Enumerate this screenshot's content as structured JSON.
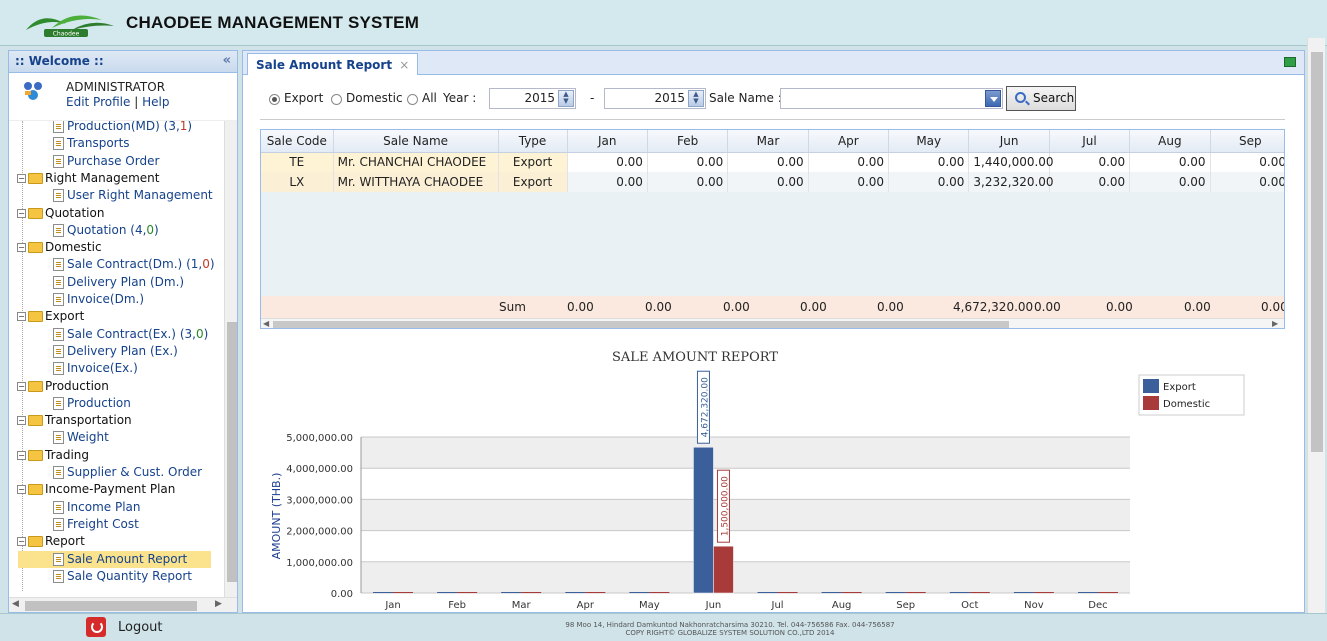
{
  "app": {
    "title": "CHAODEE MANAGEMENT SYSTEM",
    "logo_text": "Chaodee"
  },
  "sidebar": {
    "header": ":: Welcome ::",
    "user_name": "ADMINISTRATOR",
    "edit_profile": "Edit Profile",
    "sep": "|",
    "help": "Help",
    "tree": [
      {
        "type": "leaf",
        "label": "Production(MD)",
        "counts": [
          "(3,",
          "1",
          ")"
        ],
        "count_style": "c"
      },
      {
        "type": "leaf",
        "label": "Transports"
      },
      {
        "type": "leaf",
        "label": "Purchase Order"
      },
      {
        "type": "folder",
        "label": "Right Management"
      },
      {
        "type": "leaf",
        "label": "User Right Management"
      },
      {
        "type": "folder",
        "label": "Quotation"
      },
      {
        "type": "leaf",
        "label": "Quotation",
        "counts": [
          "(4,",
          "0",
          ")"
        ],
        "count_style": "b"
      },
      {
        "type": "folder",
        "label": "Domestic"
      },
      {
        "type": "leaf",
        "label": "Sale Contract(Dm.)",
        "counts": [
          "(1,",
          "0",
          ")"
        ],
        "count_style": "bc"
      },
      {
        "type": "leaf",
        "label": "Delivery Plan (Dm.)"
      },
      {
        "type": "leaf",
        "label": "Invoice(Dm.)"
      },
      {
        "type": "folder",
        "label": "Export"
      },
      {
        "type": "leaf",
        "label": "Sale Contract(Ex.)",
        "counts": [
          "(3,",
          "0",
          ")"
        ],
        "count_style": "b"
      },
      {
        "type": "leaf",
        "label": "Delivery Plan (Ex.)"
      },
      {
        "type": "leaf",
        "label": "Invoice(Ex.)"
      },
      {
        "type": "folder",
        "label": "Production"
      },
      {
        "type": "leaf",
        "label": "Production"
      },
      {
        "type": "folder",
        "label": "Transportation"
      },
      {
        "type": "leaf",
        "label": "Weight"
      },
      {
        "type": "folder",
        "label": "Trading"
      },
      {
        "type": "leaf",
        "label": "Supplier & Cust. Order"
      },
      {
        "type": "folder",
        "label": "Income-Payment Plan"
      },
      {
        "type": "leaf",
        "label": "Income Plan"
      },
      {
        "type": "leaf",
        "label": "Freight Cost"
      },
      {
        "type": "folder",
        "label": "Report"
      },
      {
        "type": "leaf",
        "label": "Sale Amount Report",
        "selected": true
      },
      {
        "type": "leaf",
        "label": "Sale Quantity Report"
      }
    ]
  },
  "tab": {
    "label": "Sale Amount Report",
    "close": "×"
  },
  "filter": {
    "export_label": "Export",
    "domestic_label": "Domestic",
    "all_label": "All",
    "selected": "Export",
    "year_label": "Year :",
    "year_from": "2015",
    "dash": "-",
    "year_to": "2015",
    "sale_name_label": "Sale Name :",
    "sale_name_value": "",
    "search_label": "Search"
  },
  "grid": {
    "columns": [
      "Sale Code",
      "Sale Name",
      "Type",
      "Jan",
      "Feb",
      "Mar",
      "Apr",
      "May",
      "Jun",
      "Jul",
      "Aug",
      "Sep"
    ],
    "rows": [
      [
        "TE",
        "Mr. CHANCHAI CHAODEE",
        "Export",
        "0.00",
        "0.00",
        "0.00",
        "0.00",
        "0.00",
        "1,440,000.00",
        "0.00",
        "0.00",
        "0.00"
      ],
      [
        "LX",
        "Mr. WITTHAYA CHAODEE",
        "Export",
        "0.00",
        "0.00",
        "0.00",
        "0.00",
        "0.00",
        "3,232,320.00",
        "0.00",
        "0.00",
        "0.00"
      ]
    ],
    "sum_label": "Sum",
    "sum_values": [
      "0.00",
      "0.00",
      "0.00",
      "0.00",
      "0.00",
      "4,672,320.00",
      "0.00",
      "0.00",
      "0.00",
      "0.00"
    ]
  },
  "chart_data": {
    "type": "bar",
    "title": "SALE AMOUNT REPORT",
    "ylabel": "AMOUNT (THB.)",
    "xlabel": "",
    "categories": [
      "Jan",
      "Feb",
      "Mar",
      "Apr",
      "May",
      "Jun",
      "Jul",
      "Aug",
      "Sep",
      "Oct",
      "Nov",
      "Dec"
    ],
    "series": [
      {
        "name": "Export",
        "color": "#3a5f9a",
        "values": [
          0,
          0,
          0,
          0,
          0,
          4672320,
          0,
          0,
          0,
          0,
          0,
          0
        ]
      },
      {
        "name": "Domestic",
        "color": "#a83a3a",
        "values": [
          0,
          0,
          0,
          0,
          0,
          1500000,
          0,
          0,
          0,
          0,
          0,
          0
        ]
      }
    ],
    "data_labels": [
      "4,672,320.00",
      "1,500,000.00"
    ],
    "yticks": [
      "0.00",
      "1,000,000.00",
      "2,000,000.00",
      "3,000,000.00",
      "4,000,000.00",
      "5,000,000.00"
    ],
    "ylim": [
      0,
      5000000
    ],
    "grid": true,
    "legend": "top-right"
  },
  "footer": {
    "logout_label": "Logout",
    "address": "98 Moo 14, Hindard Damkuntod Nakhonratcharsima 30210. Tel. 044-756586 Fax. 044-756587",
    "copyright": "COPY RIGHT© GLOBALIZE SYSTEM SOLUTION CO.,LTD 2014"
  }
}
